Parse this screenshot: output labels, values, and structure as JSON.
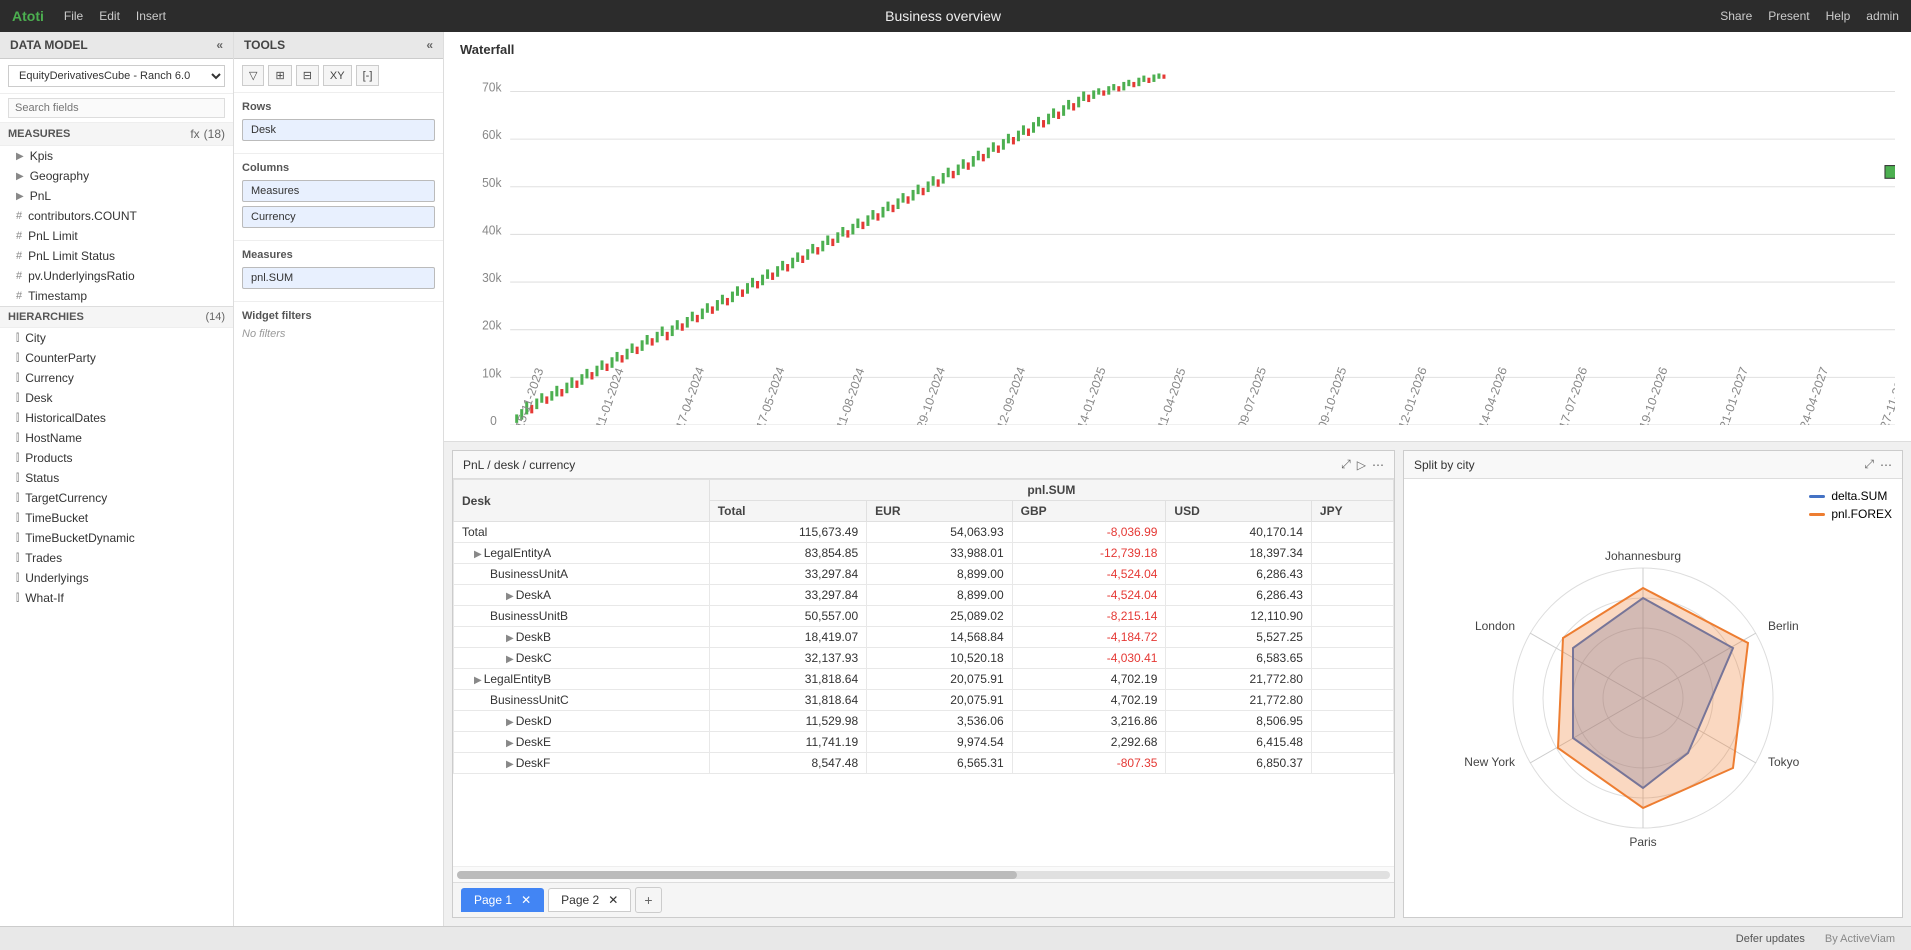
{
  "topbar": {
    "logo": "Atoti",
    "menu": [
      "File",
      "Edit",
      "Insert"
    ],
    "title": "Business overview",
    "actions": [
      "Share",
      "Present",
      "Help",
      "admin"
    ]
  },
  "left_panel": {
    "header": "DATA MODEL",
    "cube": "EquityDerivativesCube - Ranch 6.0",
    "search_placeholder": "Search fields",
    "measures_label": "MEASURES",
    "measures_count": "(18)",
    "measures_items": [
      {
        "type": "group",
        "label": "Kpis"
      },
      {
        "type": "group",
        "label": "Geography"
      },
      {
        "type": "group",
        "label": "PnL"
      },
      {
        "type": "leaf",
        "label": "contributors.COUNT"
      },
      {
        "type": "leaf",
        "label": "PnL Limit"
      },
      {
        "type": "leaf",
        "label": "PnL Limit Status"
      },
      {
        "type": "leaf",
        "label": "pv.UnderlyingsRatio"
      },
      {
        "type": "leaf",
        "label": "Timestamp"
      }
    ],
    "hierarchies_label": "HIERARCHIES",
    "hierarchies_count": "(14)",
    "hierarchies_items": [
      "City",
      "CounterParty",
      "Currency",
      "Desk",
      "HistoricalDates",
      "HostName",
      "Products",
      "Status",
      "TargetCurrency",
      "TimeBucket",
      "TimeBucketDynamic",
      "Trades",
      "Underlyings",
      "What-If"
    ]
  },
  "tools_panel": {
    "header": "TOOLS",
    "toolbar_buttons": [
      "filter",
      "sort",
      "pivot",
      "xy",
      "minus"
    ],
    "rows_label": "Rows",
    "rows_items": [
      "Desk"
    ],
    "columns_label": "Columns",
    "columns_items": [
      "Measures",
      "Currency"
    ],
    "measures_label": "Measures",
    "measures_items": [
      "pnl.SUM"
    ],
    "widget_filters_label": "Widget filters",
    "no_filters": "No filters"
  },
  "waterfall": {
    "title": "Waterfall",
    "y_labels": [
      "0",
      "10k",
      "20k",
      "30k",
      "40k",
      "50k",
      "60k",
      "70k"
    ]
  },
  "table": {
    "title": "PnL / desk / currency",
    "col_headers": [
      "Desk",
      "pnl.SUM",
      "",
      "",
      "",
      ""
    ],
    "sub_headers": [
      "",
      "Total",
      "EUR",
      "GBP",
      "USD",
      "JPY"
    ],
    "rows": [
      {
        "label": "Total",
        "indent": 0,
        "total": "115,673.49",
        "eur": "54,063.93",
        "gbp": "-8,036.99",
        "usd": "40,170.14",
        "gbp_neg": true
      },
      {
        "label": "LegalEntityA",
        "indent": 1,
        "total": "83,854.85",
        "eur": "33,988.01",
        "gbp": "-12,739.18",
        "usd": "18,397.34",
        "gbp_neg": true
      },
      {
        "label": "BusinessUnitA",
        "indent": 2,
        "total": "33,297.84",
        "eur": "8,899.00",
        "gbp": "-4,524.04",
        "usd": "6,286.43",
        "gbp_neg": true
      },
      {
        "label": "DeskA",
        "indent": 3,
        "total": "33,297.84",
        "eur": "8,899.00",
        "gbp": "-4,524.04",
        "usd": "6,286.43",
        "gbp_neg": true
      },
      {
        "label": "BusinessUnitB",
        "indent": 2,
        "total": "50,557.00",
        "eur": "25,089.02",
        "gbp": "-8,215.14",
        "usd": "12,110.90",
        "gbp_neg": true
      },
      {
        "label": "DeskB",
        "indent": 3,
        "total": "18,419.07",
        "eur": "14,568.84",
        "gbp": "-4,184.72",
        "usd": "5,527.25",
        "gbp_neg": true
      },
      {
        "label": "DeskC",
        "indent": 3,
        "total": "32,137.93",
        "eur": "10,520.18",
        "gbp": "-4,030.41",
        "usd": "6,583.65",
        "gbp_neg": true
      },
      {
        "label": "LegalEntityB",
        "indent": 1,
        "total": "31,818.64",
        "eur": "20,075.91",
        "gbp": "4,702.19",
        "usd": "21,772.80",
        "gbp_neg": false
      },
      {
        "label": "BusinessUnitC",
        "indent": 2,
        "total": "31,818.64",
        "eur": "20,075.91",
        "gbp": "4,702.19",
        "usd": "21,772.80",
        "gbp_neg": false
      },
      {
        "label": "DeskD",
        "indent": 3,
        "total": "11,529.98",
        "eur": "3,536.06",
        "gbp": "3,216.86",
        "usd": "8,506.95",
        "gbp_neg": false
      },
      {
        "label": "DeskE",
        "indent": 3,
        "total": "11,741.19",
        "eur": "9,974.54",
        "gbp": "2,292.68",
        "usd": "6,415.48",
        "gbp_neg": false
      },
      {
        "label": "DeskF",
        "indent": 3,
        "total": "8,547.48",
        "eur": "6,565.31",
        "gbp": "-807.35",
        "usd": "6,850.37",
        "gbp_neg": true
      }
    ],
    "page_tabs": [
      "Page 1",
      "Page 2"
    ]
  },
  "radar": {
    "title": "Split by city",
    "cities": [
      "London",
      "Johannesburg",
      "Berlin",
      "Tokyo",
      "Paris",
      "New York"
    ],
    "legend": [
      {
        "label": "delta.SUM",
        "color": "#4472c4"
      },
      {
        "label": "pnl.FOREX",
        "color": "#ed7d31"
      }
    ]
  },
  "status_bar": {
    "defer_updates": "Defer updates",
    "powered_by": "By ActiveViam"
  }
}
